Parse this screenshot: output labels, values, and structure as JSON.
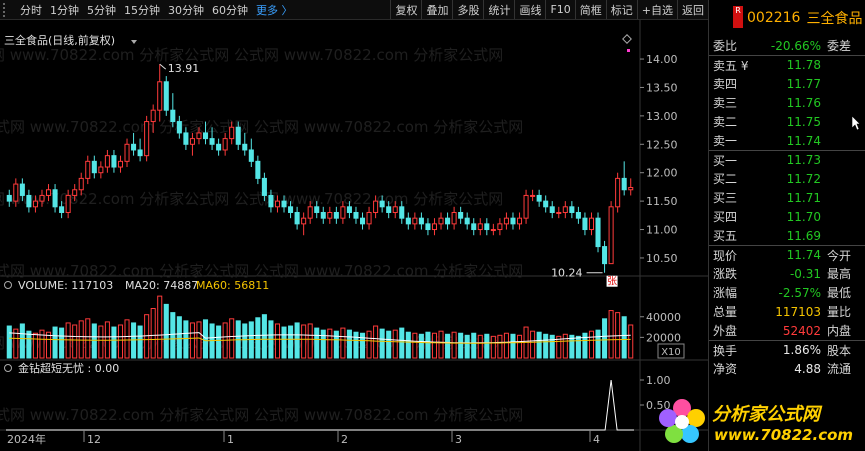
{
  "toolbar": {
    "left": [
      "分时",
      "1分钟",
      "5分钟",
      "15分钟",
      "30分钟",
      "60分钟"
    ],
    "more": "更多 〉",
    "right": [
      "复权",
      "叠加",
      "多股",
      "统计",
      "画线",
      "F10",
      "简框",
      "标记",
      "+自选",
      "返回"
    ]
  },
  "chart": {
    "title": "三全食品(日线,前复权)",
    "watermark": "公式网 www.70822.com 分析家公式网",
    "price_ticks": [
      "14.00",
      "13.50",
      "13.00",
      "12.50",
      "12.00",
      "11.50",
      "11.00",
      "10.50"
    ],
    "high_label": "13.91",
    "low_label": "10.24",
    "zhang_badge": "张",
    "volume": {
      "label": "VOLUME: 117103",
      "ma20": "MA20: 74887",
      "ma60": "MA60: 56811",
      "ticks": [
        "40000",
        "20000"
      ],
      "x10": "X10"
    },
    "indicator": {
      "label": "金钻超短无忧 : 0.00",
      "ticks": [
        "1.00",
        "0.50"
      ]
    },
    "dates": [
      "2024年",
      "12",
      "1",
      "2",
      "3",
      "4"
    ],
    "colors": {
      "up": "#ff3b3b",
      "down": "#54e6e6",
      "ma20": "#ffffff",
      "ma60": "#f5c400"
    }
  },
  "chart_data": {
    "type": "candlestick",
    "title": "三全食品(日线,前复权)",
    "price_range": [
      10.2,
      14.3
    ],
    "candles": [
      [
        11.6,
        11.7,
        11.4,
        11.5
      ],
      [
        11.5,
        11.9,
        11.4,
        11.8
      ],
      [
        11.8,
        11.9,
        11.5,
        11.6
      ],
      [
        11.6,
        11.7,
        11.3,
        11.4
      ],
      [
        11.4,
        11.6,
        11.3,
        11.5
      ],
      [
        11.5,
        11.7,
        11.4,
        11.6
      ],
      [
        11.6,
        11.8,
        11.5,
        11.7
      ],
      [
        11.7,
        11.8,
        11.3,
        11.4
      ],
      [
        11.4,
        11.5,
        11.2,
        11.3
      ],
      [
        11.3,
        11.7,
        11.2,
        11.6
      ],
      [
        11.6,
        11.8,
        11.5,
        11.7
      ],
      [
        11.7,
        12.0,
        11.6,
        11.9
      ],
      [
        11.9,
        12.3,
        11.8,
        12.2
      ],
      [
        12.2,
        12.3,
        11.9,
        12.0
      ],
      [
        12.0,
        12.2,
        11.9,
        12.1
      ],
      [
        12.1,
        12.4,
        12.0,
        12.3
      ],
      [
        12.3,
        12.4,
        12.0,
        12.1
      ],
      [
        12.1,
        12.3,
        12.0,
        12.2
      ],
      [
        12.2,
        12.6,
        12.1,
        12.5
      ],
      [
        12.5,
        12.7,
        12.3,
        12.4
      ],
      [
        12.4,
        12.6,
        12.2,
        12.3
      ],
      [
        12.3,
        13.0,
        12.2,
        12.9
      ],
      [
        12.9,
        13.2,
        12.7,
        13.1
      ],
      [
        13.1,
        13.91,
        12.9,
        13.6
      ],
      [
        13.6,
        13.7,
        13.0,
        13.1
      ],
      [
        13.1,
        13.4,
        12.8,
        12.9
      ],
      [
        12.9,
        13.0,
        12.6,
        12.7
      ],
      [
        12.7,
        12.8,
        12.4,
        12.5
      ],
      [
        12.5,
        12.7,
        12.3,
        12.6
      ],
      [
        12.6,
        12.8,
        12.5,
        12.7
      ],
      [
        12.7,
        12.9,
        12.5,
        12.6
      ],
      [
        12.6,
        12.8,
        12.4,
        12.5
      ],
      [
        12.5,
        12.6,
        12.3,
        12.4
      ],
      [
        12.4,
        12.7,
        12.3,
        12.6
      ],
      [
        12.6,
        12.9,
        12.5,
        12.8
      ],
      [
        12.8,
        12.9,
        12.4,
        12.5
      ],
      [
        12.5,
        12.7,
        12.3,
        12.4
      ],
      [
        12.4,
        12.6,
        12.1,
        12.2
      ],
      [
        12.2,
        12.3,
        11.8,
        11.9
      ],
      [
        11.9,
        12.0,
        11.5,
        11.6
      ],
      [
        11.6,
        11.7,
        11.3,
        11.4
      ],
      [
        11.4,
        11.6,
        11.3,
        11.5
      ],
      [
        11.5,
        11.6,
        11.3,
        11.4
      ],
      [
        11.4,
        11.5,
        11.2,
        11.3
      ],
      [
        11.3,
        11.4,
        11.0,
        11.1
      ],
      [
        11.1,
        11.3,
        10.9,
        11.2
      ],
      [
        11.2,
        11.5,
        11.1,
        11.4
      ],
      [
        11.4,
        11.5,
        11.2,
        11.3
      ],
      [
        11.3,
        11.4,
        11.1,
        11.2
      ],
      [
        11.2,
        11.4,
        11.1,
        11.3
      ],
      [
        11.3,
        11.4,
        11.1,
        11.2
      ],
      [
        11.2,
        11.5,
        11.1,
        11.4
      ],
      [
        11.4,
        11.5,
        11.2,
        11.3
      ],
      [
        11.3,
        11.4,
        11.1,
        11.2
      ],
      [
        11.2,
        11.3,
        11.0,
        11.1
      ],
      [
        11.1,
        11.4,
        11.0,
        11.3
      ],
      [
        11.3,
        11.6,
        11.2,
        11.5
      ],
      [
        11.5,
        11.6,
        11.3,
        11.4
      ],
      [
        11.4,
        11.5,
        11.2,
        11.3
      ],
      [
        11.3,
        11.5,
        11.2,
        11.4
      ],
      [
        11.4,
        11.5,
        11.1,
        11.2
      ],
      [
        11.2,
        11.3,
        11.0,
        11.1
      ],
      [
        11.1,
        11.3,
        11.0,
        11.2
      ],
      [
        11.2,
        11.3,
        11.0,
        11.1
      ],
      [
        11.1,
        11.2,
        10.9,
        11.0
      ],
      [
        11.0,
        11.2,
        10.9,
        11.1
      ],
      [
        11.1,
        11.3,
        11.0,
        11.2
      ],
      [
        11.2,
        11.3,
        11.0,
        11.1
      ],
      [
        11.1,
        11.4,
        11.0,
        11.3
      ],
      [
        11.3,
        11.4,
        11.1,
        11.2
      ],
      [
        11.2,
        11.3,
        11.0,
        11.1
      ],
      [
        11.1,
        11.2,
        10.9,
        11.0
      ],
      [
        11.0,
        11.2,
        10.9,
        11.1
      ],
      [
        11.1,
        11.2,
        10.9,
        11.0
      ],
      [
        11.0,
        11.1,
        10.9,
        11.0
      ],
      [
        11.0,
        11.2,
        10.9,
        11.1
      ],
      [
        11.1,
        11.3,
        11.0,
        11.2
      ],
      [
        11.2,
        11.3,
        11.0,
        11.1
      ],
      [
        11.1,
        11.3,
        11.0,
        11.2
      ],
      [
        11.2,
        11.7,
        11.1,
        11.6
      ],
      [
        11.6,
        11.7,
        11.5,
        11.6
      ],
      [
        11.6,
        11.7,
        11.4,
        11.5
      ],
      [
        11.5,
        11.6,
        11.3,
        11.4
      ],
      [
        11.4,
        11.5,
        11.2,
        11.3
      ],
      [
        11.3,
        11.4,
        11.2,
        11.3
      ],
      [
        11.3,
        11.5,
        11.2,
        11.4
      ],
      [
        11.4,
        11.5,
        11.2,
        11.3
      ],
      [
        11.3,
        11.4,
        11.1,
        11.2
      ],
      [
        11.2,
        11.3,
        10.9,
        11.0
      ],
      [
        11.0,
        11.3,
        10.9,
        11.2
      ],
      [
        11.2,
        11.3,
        10.6,
        10.7
      ],
      [
        10.7,
        10.8,
        10.24,
        10.4
      ],
      [
        10.4,
        11.5,
        10.4,
        11.4
      ],
      [
        11.4,
        12.0,
        11.3,
        11.9
      ],
      [
        11.9,
        12.2,
        11.6,
        11.7
      ],
      [
        11.7,
        11.9,
        11.6,
        11.74
      ]
    ],
    "volume": [
      31,
      28,
      33,
      26,
      24,
      27,
      25,
      30,
      29,
      34,
      32,
      36,
      38,
      33,
      31,
      35,
      30,
      32,
      37,
      34,
      31,
      42,
      48,
      60,
      52,
      44,
      40,
      36,
      34,
      35,
      37,
      33,
      31,
      34,
      38,
      36,
      33,
      35,
      39,
      42,
      36,
      33,
      30,
      31,
      34,
      32,
      33,
      29,
      27,
      28,
      26,
      29,
      27,
      25,
      24,
      26,
      31,
      28,
      26,
      27,
      29,
      25,
      24,
      23,
      25,
      24,
      26,
      23,
      25,
      24,
      22,
      24,
      22,
      23,
      21,
      22,
      24,
      23,
      22,
      30,
      26,
      25,
      23,
      22,
      21,
      23,
      22,
      21,
      24,
      26,
      27,
      38,
      46,
      44,
      40,
      32
    ],
    "ma20_level": 0.32,
    "ma60_level": 0.27,
    "indicator_spike_index": 92,
    "indicator_value": 0.0
  },
  "panel": {
    "code": "002216",
    "name": "三全食品",
    "badge": "R",
    "rows": [
      {
        "l": "委比",
        "v": "-20.66%",
        "c": "green",
        "r": "委差"
      },
      {
        "l": "卖五 ¥",
        "v": "11.78",
        "c": "green",
        "r": ""
      },
      {
        "l": "卖四",
        "v": "11.77",
        "c": "green",
        "r": ""
      },
      {
        "l": "卖三",
        "v": "11.76",
        "c": "green",
        "r": ""
      },
      {
        "l": "卖二",
        "v": "11.75",
        "c": "green",
        "r": ""
      },
      {
        "l": "卖一",
        "v": "11.74",
        "c": "green",
        "r": ""
      },
      {
        "l": "买一",
        "v": "11.73",
        "c": "green",
        "r": ""
      },
      {
        "l": "买二",
        "v": "11.72",
        "c": "green",
        "r": ""
      },
      {
        "l": "买三",
        "v": "11.71",
        "c": "green",
        "r": ""
      },
      {
        "l": "买四",
        "v": "11.70",
        "c": "green",
        "r": ""
      },
      {
        "l": "买五",
        "v": "11.69",
        "c": "green",
        "r": ""
      },
      {
        "l": "现价",
        "v": "11.74",
        "c": "green",
        "r": "今开"
      },
      {
        "l": "涨跌",
        "v": "-0.31",
        "c": "green",
        "r": "最高"
      },
      {
        "l": "涨幅",
        "v": "-2.57%",
        "c": "green",
        "r": "最低"
      },
      {
        "l": "总量",
        "v": "117103",
        "c": "yellow",
        "r": "量比"
      },
      {
        "l": "外盘",
        "v": "52402",
        "c": "red",
        "r": "内盘"
      },
      {
        "l": "换手",
        "v": "1.86%",
        "c": "white",
        "r": "股本"
      },
      {
        "l": "净资",
        "v": "4.88",
        "c": "white",
        "r": "流通"
      }
    ]
  },
  "logo": {
    "text": "分析家公式网",
    "url": "www.70822.com"
  }
}
